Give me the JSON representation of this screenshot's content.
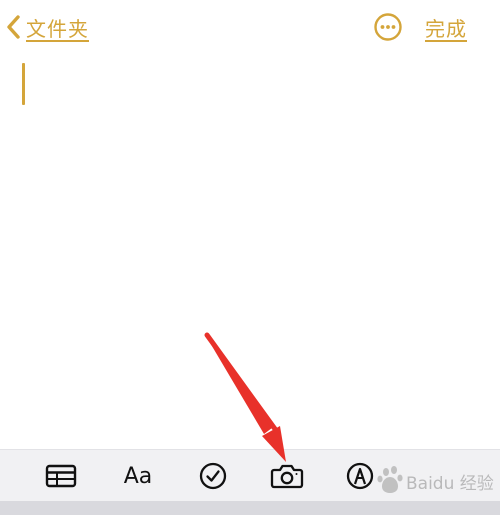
{
  "nav": {
    "back_label": "文件夹",
    "done_label": "完成"
  },
  "note": {
    "content": ""
  },
  "toolbar": {
    "format_label": "Aa"
  },
  "icons": {
    "back": "chevron-left-icon",
    "more": "ellipsis-circle-icon",
    "table": "table-icon",
    "checklist": "checkmark-circle-icon",
    "camera": "camera-icon",
    "markup": "pen-tip-circle-icon"
  },
  "colors": {
    "accent": "#d4a53a",
    "annotation_arrow": "#e8312a",
    "toolbar_bg": "#f1f1f3",
    "icon": "#111111"
  },
  "watermark": {
    "text": "Baidu 经验"
  }
}
